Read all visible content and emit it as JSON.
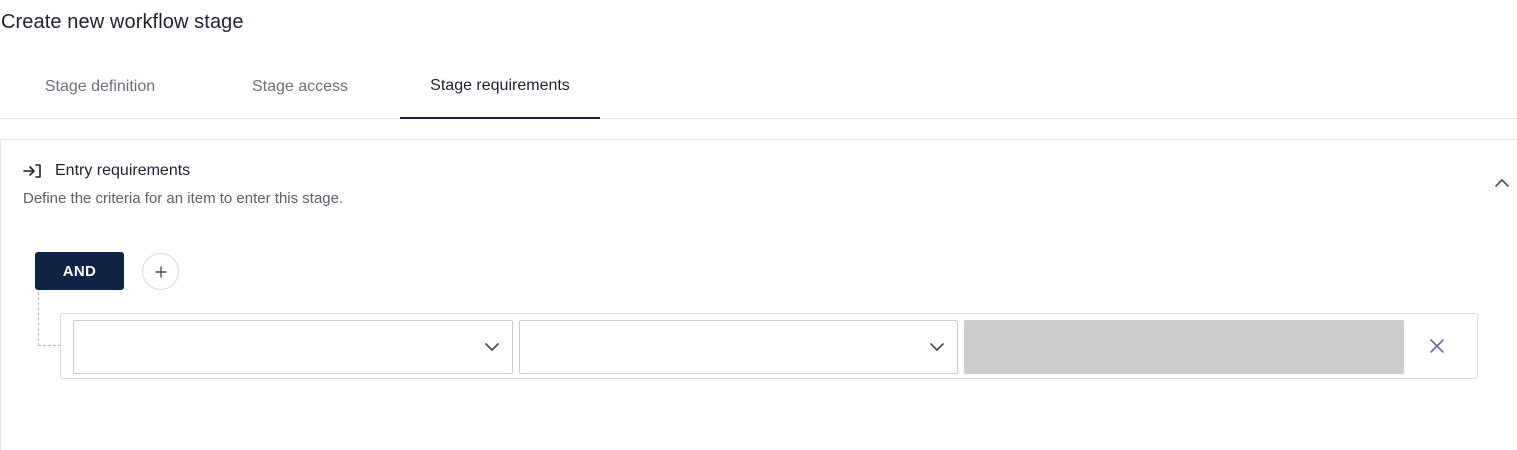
{
  "page": {
    "title": "Create new workflow stage"
  },
  "tabs": [
    {
      "label": "Stage definition",
      "active": false
    },
    {
      "label": "Stage access",
      "active": false
    },
    {
      "label": "Stage requirements",
      "active": true
    }
  ],
  "entry_requirements": {
    "icon": "enter-arrow-icon",
    "title": "Entry requirements",
    "description": "Define the criteria for an item to enter this stage.",
    "collapse_icon": "chevron-up-icon",
    "logic_operator": "AND",
    "add_icon": "plus-icon",
    "rules": [
      {
        "field_select_value": "",
        "operator_select_value": "",
        "value_input_value": "",
        "remove_icon": "close-icon"
      }
    ]
  },
  "colors": {
    "primary": "#0e2346",
    "tab_inactive": "#6b6f78",
    "border": "#e3e5e9",
    "disabled_fill": "#cccccc",
    "remove_icon": "#6e6a9a"
  }
}
